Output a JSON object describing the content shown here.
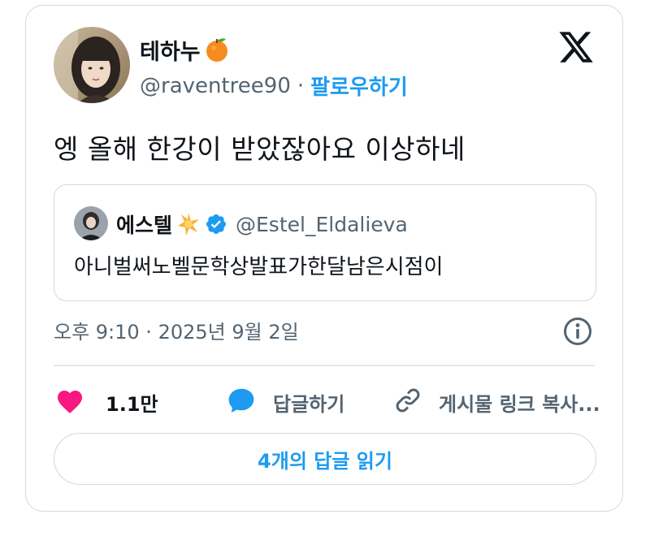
{
  "author": {
    "display_name": "테하누",
    "name_emoji": "orange-emoji",
    "handle": "@raventree90",
    "separator": "·",
    "follow_label": "팔로우하기"
  },
  "logo": "x-logo-icon",
  "tweet": {
    "text": "엥 올해 한강이 받았잖아요 이상하네",
    "timestamp": "오후 9:10 · 2025년 9월 2일"
  },
  "quoted_tweet": {
    "display_name": "에스텔",
    "name_emoji": "sparkle-star-emoji",
    "verified": true,
    "handle": "@Estel_Eldalieva",
    "text": "아니벌써노벨문학상발표가한달남은시점이"
  },
  "actions": {
    "like_count": "1.1만",
    "reply_label": "답글하기",
    "copy_link_label": "게시물 링크 복사..."
  },
  "read_replies_label": "4개의 답글 읽기",
  "colors": {
    "accent": "#1d9bf0",
    "like": "#f91880",
    "muted_text": "#536471",
    "border": "#cfd9de"
  }
}
